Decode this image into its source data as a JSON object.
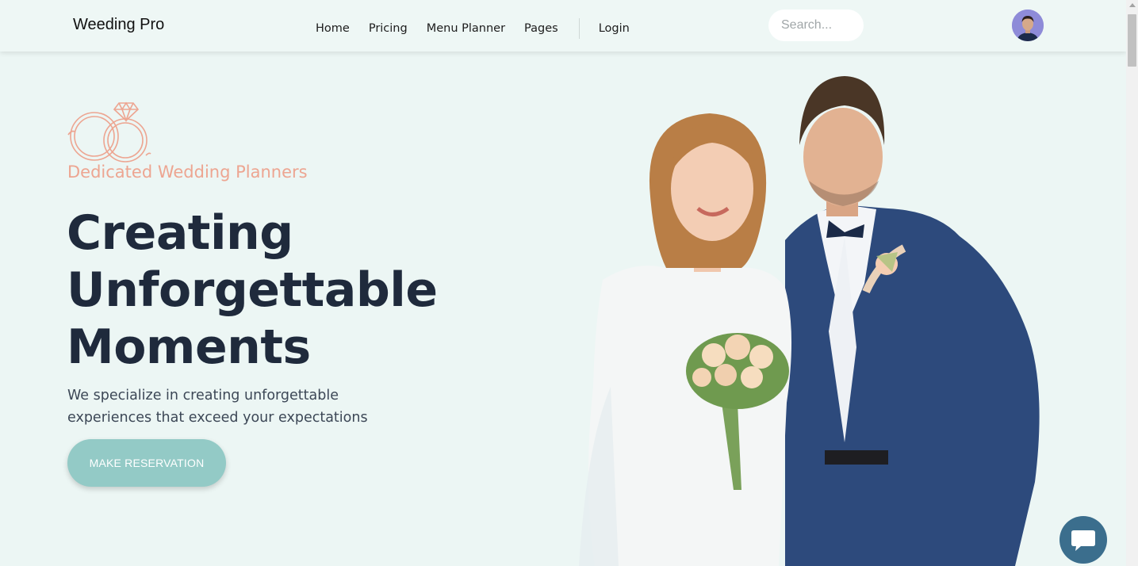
{
  "header": {
    "brand": "Weeding Pro",
    "nav": [
      {
        "label": "Home"
      },
      {
        "label": "Pricing"
      },
      {
        "label": "Menu Planner"
      },
      {
        "label": "Pages"
      }
    ],
    "login_label": "Login",
    "search": {
      "placeholder": "Search...",
      "value": ""
    }
  },
  "hero": {
    "tagline": "Dedicated Wedding Planners",
    "headline_lines": [
      "Creating",
      "Unforgettable",
      "Moments"
    ],
    "subtitle_lines": [
      "We specialize in creating unforgettable",
      "experiences that exceed your expectations"
    ],
    "cta_label": "MAKE RESERVATION"
  },
  "colors": {
    "background": "#ecf6f4",
    "accent_peach": "#eda591",
    "cta_teal": "#93cac6",
    "heading_navy": "#1f2a3c",
    "chat_blue": "#3b6e8d"
  },
  "icons": {
    "rings": "wedding-rings-icon",
    "chat": "chat-bubble-icon",
    "avatar": "user-avatar"
  }
}
